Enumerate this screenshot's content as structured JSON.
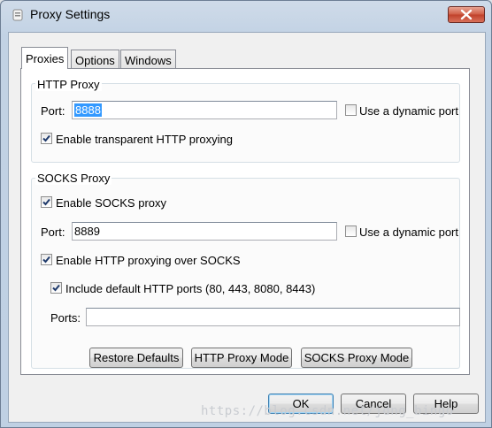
{
  "window": {
    "title": "Proxy Settings",
    "close_icon": "close-icon"
  },
  "tabs": [
    {
      "label": "Proxies",
      "active": true
    },
    {
      "label": "Options",
      "active": false
    },
    {
      "label": "Windows",
      "active": false
    }
  ],
  "http_proxy": {
    "group_label": "HTTP Proxy",
    "port_label": "Port:",
    "port_value": "8888",
    "dynamic_port_label": "Use a dynamic port",
    "dynamic_port_checked": false,
    "transparent_label": "Enable transparent HTTP proxying",
    "transparent_checked": true
  },
  "socks_proxy": {
    "group_label": "SOCKS Proxy",
    "enable_label": "Enable SOCKS proxy",
    "enable_checked": true,
    "port_label": "Port:",
    "port_value": "8889",
    "dynamic_port_label": "Use a dynamic port",
    "dynamic_port_checked": false,
    "http_over_socks_label": "Enable HTTP proxying over SOCKS",
    "http_over_socks_checked": true,
    "include_default_label": "Include default HTTP ports (80, 443, 8080, 8443)",
    "include_default_checked": true,
    "ports_label": "Ports:",
    "ports_value": ""
  },
  "buttons": {
    "restore_defaults": "Restore Defaults",
    "http_proxy_mode": "HTTP Proxy Mode",
    "socks_proxy_mode": "SOCKS Proxy Mode",
    "ok": "OK",
    "cancel": "Cancel",
    "help": "Help"
  },
  "watermark": "https://blog.csdn.net/jdng_bingo"
}
